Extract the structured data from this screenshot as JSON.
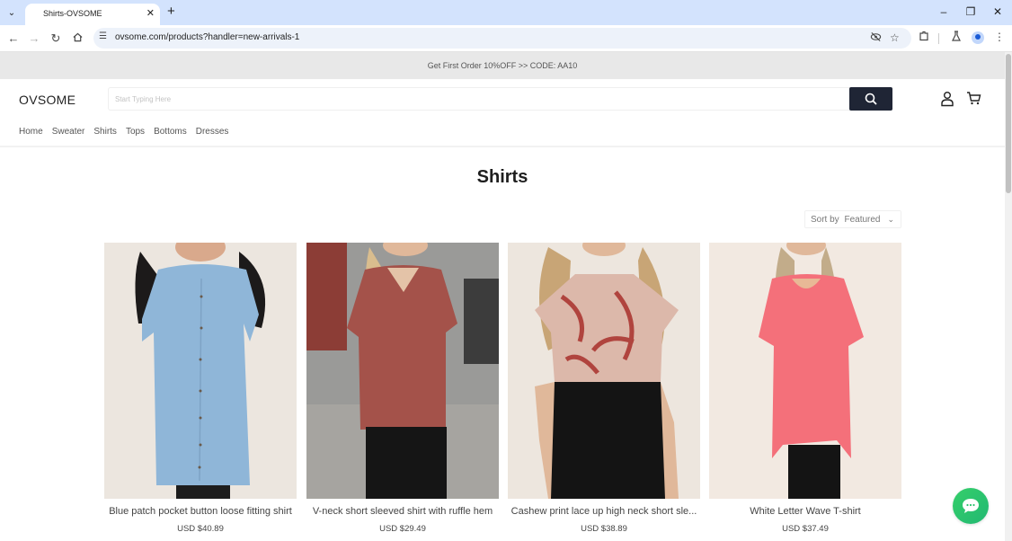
{
  "browser": {
    "tab_title": "Shirts-OVSOME",
    "url": "ovsome.com/products?handler=new-arrivals-1",
    "icons": {
      "tab_search": "chevron-down-icon",
      "tab_close": "close-icon",
      "new_tab": "plus-icon",
      "minimize": "minimize-icon",
      "restore": "restore-icon",
      "close_window": "close-icon",
      "back": "arrow-left-icon",
      "forward": "arrow-right-icon",
      "reload": "reload-icon",
      "home": "home-icon",
      "site_info": "tune-icon",
      "eye_off": "eye-off-icon",
      "bookmark": "star-icon",
      "extensions": "puzzle-icon",
      "labs": "flask-icon",
      "profile": "avatar-icon",
      "menu": "kebab-icon"
    }
  },
  "announcement": "Get First Order 10%OFF >> CODE: AA10",
  "header": {
    "logo": "OVSOME",
    "search_placeholder": "Start Typing Here",
    "search_value": "",
    "nav": [
      "Home",
      "Sweater",
      "Shirts",
      "Tops",
      "Bottoms",
      "Dresses"
    ]
  },
  "page_title": "Shirts",
  "sort": {
    "label": "Sort by",
    "value": "Featured"
  },
  "products": [
    {
      "name": "Blue patch pocket button loose fitting shirt",
      "price": "USD $40.89"
    },
    {
      "name": "V-neck short sleeved shirt with ruffle hem",
      "price": "USD $29.49"
    },
    {
      "name": "Cashew print lace up high neck short sle...",
      "price": "USD $38.89"
    },
    {
      "name": "White Letter Wave T-shirt",
      "price": "USD $37.49"
    }
  ],
  "colors": {
    "search_button": "#1f2535",
    "announcement_bg": "#e8e8e8",
    "chat_button": "#2cc46e"
  }
}
